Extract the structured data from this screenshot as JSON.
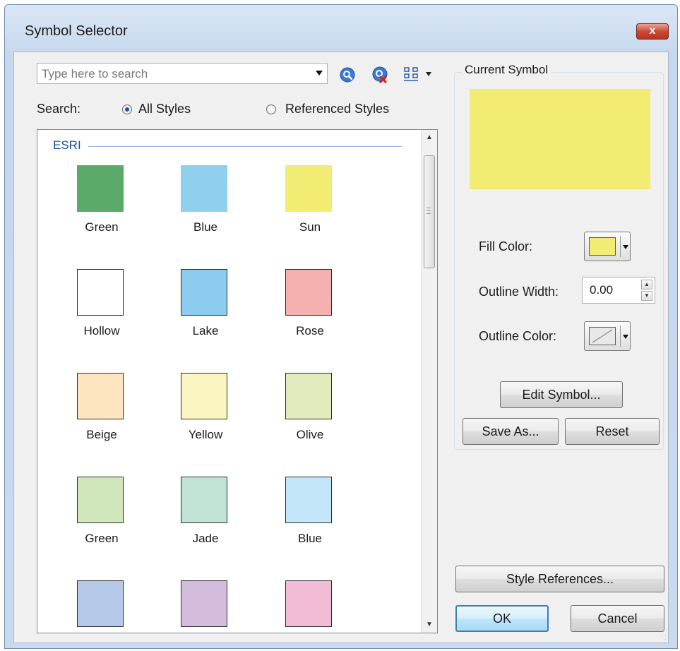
{
  "window": {
    "title": "Symbol Selector",
    "close_glyph": "x"
  },
  "search": {
    "placeholder": "Type here to search",
    "value": "",
    "scope_label": "Search:",
    "all_styles_label": "All Styles",
    "referenced_styles_label": "Referenced Styles",
    "selected_scope": "All Styles",
    "icons": [
      "search-icon",
      "clear-search-icon",
      "view-options-icon"
    ]
  },
  "gallery": {
    "group_name": "ESRI",
    "symbols": [
      {
        "label": "Green",
        "color": "#5aaa6a",
        "outline": false
      },
      {
        "label": "Blue",
        "color": "#8fd0ee",
        "outline": false
      },
      {
        "label": "Sun",
        "color": "#f2ec73",
        "outline": false
      },
      {
        "label": "Hollow",
        "color": "#ffffff",
        "outline": true
      },
      {
        "label": "Lake",
        "color": "#8ccdef",
        "outline": true
      },
      {
        "label": "Rose",
        "color": "#f4b1b0",
        "outline": true
      },
      {
        "label": "Beige",
        "color": "#fde5c0",
        "outline": true
      },
      {
        "label": "Yellow",
        "color": "#fbf6c1",
        "outline": true
      },
      {
        "label": "Olive",
        "color": "#e1ebbd",
        "outline": true
      },
      {
        "label": "Green",
        "color": "#d0e7bc",
        "outline": true
      },
      {
        "label": "Jade",
        "color": "#bfe3d5",
        "outline": true
      },
      {
        "label": "Blue",
        "color": "#c3e6f8",
        "outline": true
      },
      {
        "label": "",
        "color": "#b7c9e8",
        "outline": true
      },
      {
        "label": "",
        "color": "#d4bcdd",
        "outline": true
      },
      {
        "label": "",
        "color": "#f3bcd6",
        "outline": true
      }
    ]
  },
  "current_symbol": {
    "group_label": "Current Symbol",
    "preview_color": "#f2ec73",
    "fill_color_label": "Fill Color:",
    "fill_color": "#f2ec73",
    "outline_width_label": "Outline Width:",
    "outline_width": "0.00",
    "outline_color_label": "Outline Color:",
    "edit_symbol_label": "Edit Symbol...",
    "save_as_label": "Save As...",
    "reset_label": "Reset"
  },
  "footer": {
    "style_references_label": "Style References...",
    "ok_label": "OK",
    "cancel_label": "Cancel"
  }
}
